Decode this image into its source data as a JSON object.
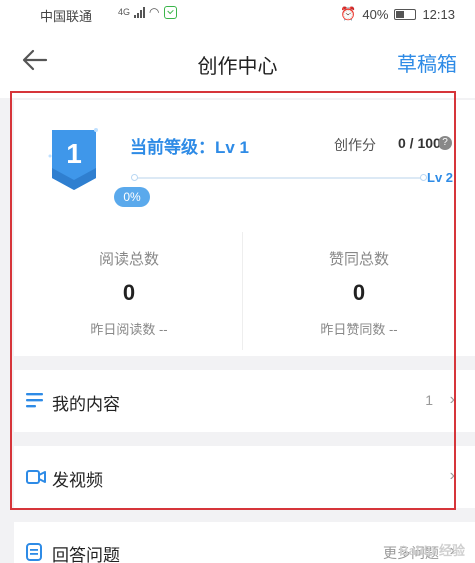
{
  "status_bar": {
    "carrier": "中国联通",
    "network": "4G",
    "battery": "40%",
    "time": "12:13"
  },
  "nav": {
    "back_icon": "back-arrow-icon",
    "title": "创作中心",
    "drafts_label": "草稿箱"
  },
  "level_card": {
    "badge_number": "1",
    "current_level_label": "当前等级：Lv 1",
    "score_label": "创作分",
    "score_value": "0 / 100",
    "help_icon": "?",
    "progress_percent": "0%",
    "progress_fraction": 0.0,
    "next_level_label": "Lv 2"
  },
  "stats": {
    "reads": {
      "label": "阅读总数",
      "value": "0",
      "yesterday": "昨日阅读数 --"
    },
    "likes": {
      "label": "赞同总数",
      "value": "0",
      "yesterday": "昨日赞同数 --"
    }
  },
  "menu": {
    "my_content": {
      "label": "我的内容",
      "count": "1",
      "icon": "list-icon"
    },
    "post_video": {
      "label": "发视频",
      "icon": "video-camera-icon"
    },
    "answer_questions": {
      "label": "回答问题",
      "more_label": "更多问题",
      "icon": "document-icon"
    }
  },
  "colors": {
    "accent": "#2e8be6",
    "highlight_border": "#d6353a",
    "badge_blue": "#3f97ea"
  },
  "watermark": "Baidu 经验"
}
